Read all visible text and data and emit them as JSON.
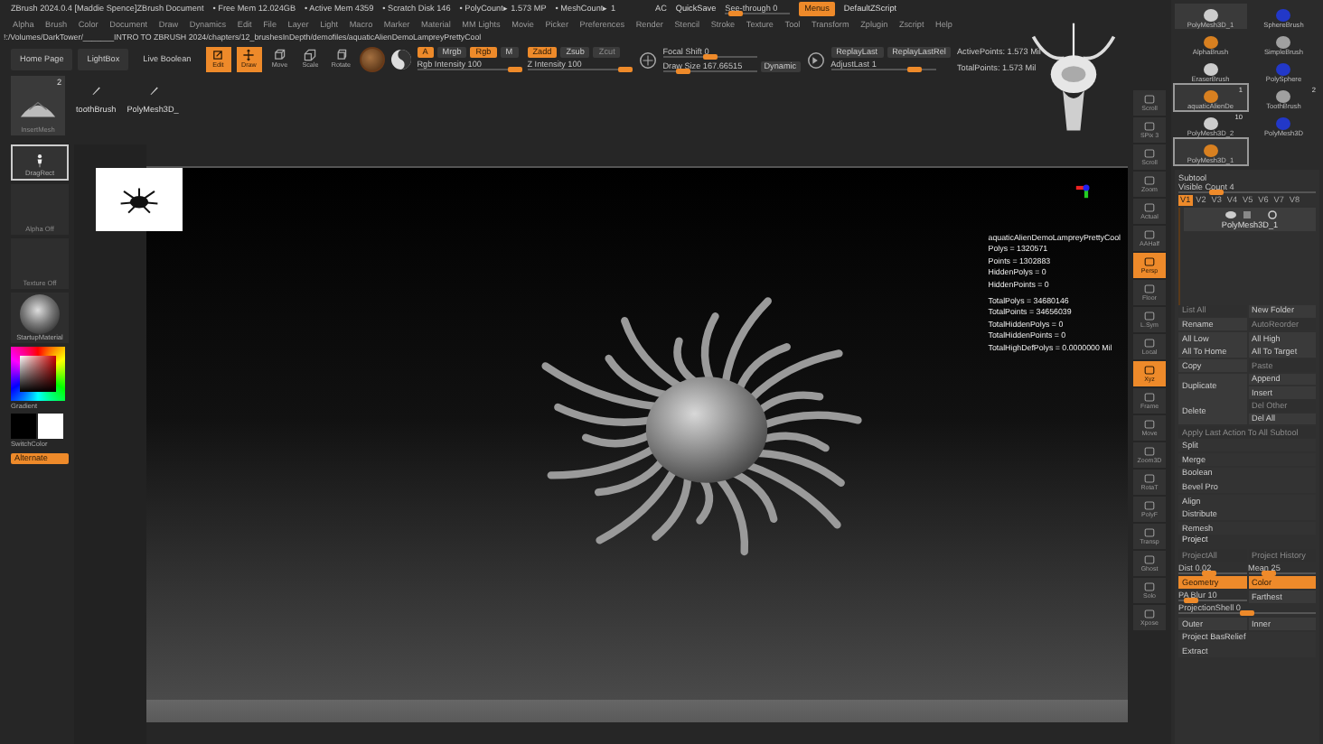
{
  "title_bar": {
    "title": "ZBrush 2024.0.4 [Maddie Spence]ZBrush Document",
    "stats": [
      "• Free Mem 12.024GB",
      "• Active Mem 4359",
      "• Scratch Disk 146",
      "• PolyCount▸ 1.573 MP",
      "• MeshCount▸ 1"
    ],
    "ac": "AC",
    "quicksave": "QuickSave",
    "see_through": {
      "label": "See-through  0",
      "level": 0.05
    },
    "menus": {
      "label": "Menus",
      "on": true
    },
    "script": "DefaultZScript"
  },
  "menu_bar": [
    "Alpha",
    "Brush",
    "Color",
    "Document",
    "Draw",
    "Dynamics",
    "Edit",
    "File",
    "Layer",
    "Light",
    "Macro",
    "Marker",
    "Material",
    "MM Lights",
    "Movie",
    "Picker",
    "Preferences",
    "Render",
    "Stencil",
    "Stroke",
    "Texture",
    "Tool",
    "Transform",
    "Zplugin",
    "Zscript",
    "Help"
  ],
  "path": "!:/Volumes/DarkTower/_______INTRO TO ZBRUSH 2024/chapters/12_brushesInDepth/demofiles/aquaticAlienDemoLampreyPrettyCool",
  "toolbar": {
    "nav": [
      "Home Page",
      "LightBox",
      "Live Boolean"
    ],
    "modes": [
      {
        "kind": "edit",
        "label": "Edit",
        "on": true
      },
      {
        "kind": "draw",
        "label": "Draw",
        "on": true
      },
      {
        "kind": "move",
        "label": "Move",
        "on": false
      },
      {
        "kind": "scale",
        "label": "Scale",
        "on": false
      },
      {
        "kind": "rotate",
        "label": "Rotate",
        "on": false
      }
    ],
    "channels": [
      {
        "label": "A",
        "on": true
      },
      {
        "label": "Mrgb",
        "on": false
      },
      {
        "label": "Rgb",
        "on": true
      },
      {
        "label": "M",
        "on": false
      }
    ],
    "rgb_intensity": {
      "label": "Rgb Intensity 100",
      "level": 1
    },
    "z_modes": [
      {
        "label": "Zadd",
        "on": true,
        "disabled": false
      },
      {
        "label": "Zsub",
        "on": false,
        "disabled": false
      },
      {
        "label": "Zcut",
        "on": false,
        "disabled": true
      }
    ],
    "z_intensity": {
      "label": "Z Intensity 100",
      "level": 1
    },
    "focal_shift": {
      "label": "Focal Shift 0",
      "level": 0.5
    },
    "draw_size": {
      "label": "Draw Size 167.66515",
      "level": 0.16
    },
    "dynamic": "Dynamic",
    "replay": [
      "ReplayLast",
      "ReplayLastRel"
    ],
    "adjust_last": {
      "label": "AdjustLast 1",
      "level": 0.85
    },
    "points": [
      "ActivePoints: 1.573 Mil",
      "TotalPoints: 1.573 Mil"
    ]
  },
  "shelf": {
    "current": {
      "label": "InsertMesh",
      "badge": "2"
    },
    "brushes": [
      "toothBrush",
      "PolyMesh3D_"
    ]
  },
  "left_shelf": [
    {
      "kind": "tile",
      "label": "DragRect",
      "disabled": false
    },
    {
      "kind": "tile",
      "label": "Alpha Off",
      "disabled": true
    },
    {
      "kind": "tile",
      "label": "Texture Off",
      "disabled": true
    },
    {
      "kind": "material",
      "label": "StartupMaterial",
      "disabled": false
    },
    {
      "kind": "picker",
      "label": "Gradient",
      "disabled": false
    },
    {
      "kind": "swatch",
      "label": "SwitchColor",
      "disabled": false
    },
    {
      "kind": "toggle",
      "label": "Alternate",
      "disabled": false
    }
  ],
  "canvas": {
    "stats": [
      {
        "lines": [
          "aquaticAlienDemoLampreyPrettyCool",
          "Polys = 1320571",
          "Points = 1302883",
          "HiddenPolys = 0",
          "HiddenPoints = 0"
        ]
      },
      {
        "lines": [
          "TotalPolys = 34680146",
          "TotalPoints = 34656039",
          "TotalHiddenPolys = 0",
          "TotalHiddenPoints = 0",
          "TotalHighDefPolys = 0.0000000 Mil"
        ]
      }
    ]
  },
  "right_shelf": [
    {
      "label": "Scroll",
      "on": false
    },
    {
      "label": "SPix 3",
      "on": false
    },
    {
      "label": "Scroll",
      "on": false
    },
    {
      "label": "Zoom",
      "on": false
    },
    {
      "label": "Actual",
      "on": false
    },
    {
      "label": "AAHalf",
      "on": false
    },
    {
      "label": "Persp",
      "on": true
    },
    {
      "label": "Floor",
      "on": false
    },
    {
      "label": "L.Sym",
      "on": false
    },
    {
      "label": "Local",
      "on": false
    },
    {
      "label": "Xyz",
      "on": true
    },
    {
      "label": "Frame",
      "on": false
    },
    {
      "label": "Move",
      "on": false
    },
    {
      "label": "Zoom3D",
      "on": false
    },
    {
      "label": "RotaT",
      "on": false
    },
    {
      "label": "PolyF",
      "on": false
    },
    {
      "label": "Transp",
      "on": false
    },
    {
      "label": "Ghost",
      "on": false
    },
    {
      "label": "Solo",
      "on": false
    },
    {
      "label": "Xpose",
      "on": false
    }
  ],
  "tool_palette": {
    "brushes": [
      {
        "label": "PolyMesh3D_1",
        "selected": false
      },
      {
        "label": "SphereBrush",
        "selected": false
      },
      {
        "label": "AlphaBrush",
        "selected": false
      },
      {
        "label": "SimpleBrush",
        "selected": false
      },
      {
        "label": "EraserBrush",
        "selected": false
      },
      {
        "label": "PolySphere",
        "selected": false
      },
      {
        "label": "aquaticAlienDe",
        "selected": true,
        "badge": "1"
      },
      {
        "label": "ToothBrush",
        "selected": false,
        "badge": "2"
      },
      {
        "label": "PolyMesh3D_2",
        "selected": false,
        "badge": "10"
      },
      {
        "label": "PolyMesh3D",
        "selected": false
      },
      {
        "label": "PolyMesh3D_1",
        "selected": true
      }
    ],
    "subtool": {
      "title": "Subtool",
      "visible_count": {
        "label": "Visible Count 4",
        "level": 0.25
      },
      "versions": [
        {
          "label": "V1",
          "selected": true
        },
        {
          "label": "V2",
          "selected": false
        },
        {
          "label": "V3",
          "selected": false
        },
        {
          "label": "V4",
          "selected": false
        },
        {
          "label": "V5",
          "selected": false
        },
        {
          "label": "V6",
          "selected": false
        },
        {
          "label": "V7",
          "selected": false
        },
        {
          "label": "V8",
          "selected": false
        }
      ],
      "items": [
        "PolyMesh3D_1"
      ],
      "rows": [
        {
          "kind": "pair",
          "items": [
            {
              "kind": "button",
              "label": "List All",
              "disabled": true
            },
            {
              "kind": "button",
              "label": "New Folder",
              "disabled": false
            }
          ]
        },
        {
          "kind": "pair",
          "items": [
            {
              "kind": "button",
              "label": "Rename",
              "disabled": false
            },
            {
              "kind": "button",
              "label": "AutoReorder",
              "disabled": true
            }
          ]
        },
        {
          "kind": "pair",
          "items": [
            {
              "kind": "button",
              "label": "All Low",
              "disabled": false
            },
            {
              "kind": "button",
              "label": "All High",
              "disabled": false
            }
          ]
        },
        {
          "kind": "pair",
          "items": [
            {
              "kind": "button",
              "label": "All To Home",
              "disabled": false
            },
            {
              "kind": "button",
              "label": "All To Target",
              "disabled": false
            }
          ]
        },
        {
          "kind": "pair",
          "items": [
            {
              "kind": "button",
              "label": "Copy",
              "disabled": false
            },
            {
              "kind": "button",
              "label": "Paste",
              "disabled": true
            }
          ]
        },
        {
          "kind": "tall",
          "items": [
            {
              "kind": "button",
              "label": "Duplicate",
              "disabled": false
            },
            {
              "kind": "button",
              "label": "Append",
              "disabled": false
            },
            {
              "kind": "button",
              "label": "Insert",
              "disabled": false
            }
          ]
        },
        {
          "kind": "tall",
          "items": [
            {
              "kind": "button",
              "label": "Delete",
              "disabled": false
            },
            {
              "kind": "button",
              "label": "Del Other",
              "disabled": true
            },
            {
              "kind": "button",
              "label": "Del All",
              "disabled": false
            }
          ]
        },
        {
          "kind": "single",
          "items": [
            {
              "kind": "button",
              "label": "Apply Last Action To All Subtool",
              "disabled": true
            }
          ]
        },
        {
          "kind": "single",
          "items": [
            {
              "kind": "plain",
              "label": "Split",
              "disabled": false
            }
          ]
        },
        {
          "kind": "single",
          "items": [
            {
              "kind": "plain",
              "label": "Merge",
              "disabled": false
            }
          ]
        },
        {
          "kind": "single",
          "items": [
            {
              "kind": "plain",
              "label": "Boolean",
              "disabled": false
            }
          ]
        },
        {
          "kind": "single",
          "items": [
            {
              "kind": "plain",
              "label": "Bevel Pro",
              "disabled": false
            }
          ]
        },
        {
          "kind": "single",
          "items": [
            {
              "kind": "plain",
              "label": "Align",
              "disabled": false
            }
          ]
        },
        {
          "kind": "single",
          "items": [
            {
              "kind": "plain",
              "label": "Distribute",
              "disabled": false
            }
          ]
        },
        {
          "kind": "single",
          "items": [
            {
              "kind": "plain",
              "label": "Remesh",
              "disabled": false
            }
          ]
        },
        {
          "kind": "single",
          "items": [
            {
              "kind": "header",
              "label": "Project",
              "disabled": false
            }
          ]
        },
        {
          "kind": "pair",
          "items": [
            {
              "kind": "button",
              "label": "ProjectAll",
              "disabled": true
            },
            {
              "kind": "button",
              "label": "Project History",
              "disabled": true
            }
          ]
        },
        {
          "kind": "pair",
          "items": [
            {
              "kind": "slider",
              "label": "Dist 0.02",
              "disabled": false,
              "level": 0.45
            },
            {
              "kind": "slider",
              "label": "Mean 25",
              "disabled": false,
              "level": 0.25
            }
          ]
        },
        {
          "kind": "pair",
          "items": [
            {
              "kind": "toggle",
              "label": "Geometry",
              "disabled": false,
              "on": true
            },
            {
              "kind": "toggle",
              "label": "Color",
              "disabled": false,
              "on": true
            }
          ]
        },
        {
          "kind": "pair",
          "items": [
            {
              "kind": "slider",
              "label": "PA Blur 10",
              "disabled": false,
              "level": 0.1
            },
            {
              "kind": "button",
              "label": "Farthest",
              "disabled": false
            }
          ]
        },
        {
          "kind": "single",
          "items": [
            {
              "kind": "slider",
              "label": "ProjectionShell 0",
              "disabled": false,
              "level": 0.5
            }
          ]
        },
        {
          "kind": "pair",
          "items": [
            {
              "kind": "button",
              "label": "Outer",
              "disabled": false
            },
            {
              "kind": "button",
              "label": "Inner",
              "disabled": false
            }
          ]
        },
        {
          "kind": "single",
          "items": [
            {
              "kind": "plain",
              "label": "Project BasRelief",
              "disabled": false
            }
          ]
        },
        {
          "kind": "single",
          "items": [
            {
              "kind": "plain",
              "label": "Extract",
              "disabled": false
            }
          ]
        }
      ]
    }
  }
}
